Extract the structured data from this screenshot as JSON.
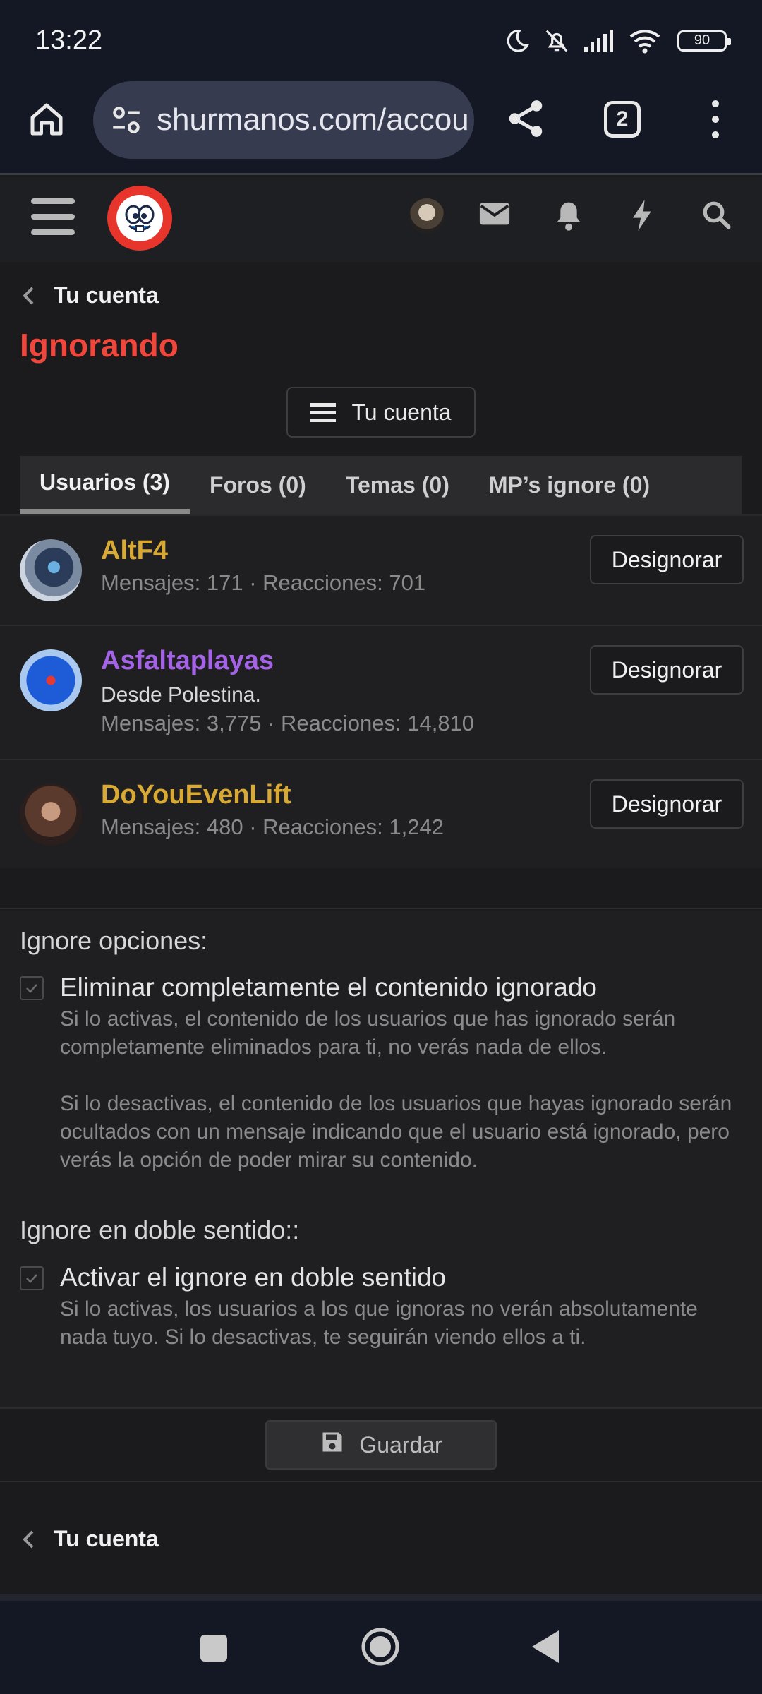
{
  "status_bar": {
    "time": "13:22",
    "battery": "90",
    "icons": [
      "moon-icon",
      "bell-off-icon",
      "signal-icon",
      "wifi-icon",
      "battery-icon"
    ]
  },
  "browser": {
    "url": "shurmanos.com/accou",
    "tab_count": "2"
  },
  "breadcrumb": {
    "label": "Tu cuenta"
  },
  "page": {
    "title": "Ignorando"
  },
  "account_menu_button": {
    "label": "Tu cuenta"
  },
  "tabs": [
    {
      "label": "Usuarios (3)",
      "active": true
    },
    {
      "label": "Foros (0)",
      "active": false
    },
    {
      "label": "Temas (0)",
      "active": false
    },
    {
      "label": "MP’s ignore (0)",
      "active": false
    }
  ],
  "users": [
    {
      "name": "AltF4",
      "name_color": "#d9a935",
      "title": "",
      "stats": "Mensajes: 171 · Reacciones: 701",
      "action": "Designorar"
    },
    {
      "name": "Asfaltaplayas",
      "name_color": "#a463e6",
      "title": "Desde Polestina.",
      "stats": "Mensajes: 3,775 · Reacciones: 14,810",
      "action": "Designorar"
    },
    {
      "name": "DoYouEvenLift",
      "name_color": "#d9a935",
      "title": "",
      "stats": "Mensajes: 480 · Reacciones: 1,242",
      "action": "Designorar"
    }
  ],
  "options": {
    "ignore_label": "Ignore opciones:",
    "remove_title": "Eliminar completamente el contenido ignorado",
    "remove_desc_1": "Si lo activas, el contenido de los usuarios que has ignorado serán completamente eliminados para ti, no verás nada de ellos.",
    "remove_desc_2": "Si lo desactivas, el contenido de los usuarios que hayas ignorado serán ocultados con un mensaje indicando que el usuario está ignorado, pero verás la opción de poder mirar su contenido.",
    "double_label": "Ignore en doble sentido::",
    "double_title": "Activar el ignore en doble sentido",
    "double_desc": "Si lo activas, los usuarios a los que ignoras no verán absolutamente nada tuyo. Si lo desactivas, te seguirán viendo ellos a ti.",
    "remove_checked": true,
    "double_checked": true
  },
  "save": {
    "label": "Guardar"
  },
  "footer_breadcrumb": {
    "label": "Tu cuenta"
  },
  "colors": {
    "accent_title": "#f0463b",
    "background": "#1b1b1d"
  }
}
